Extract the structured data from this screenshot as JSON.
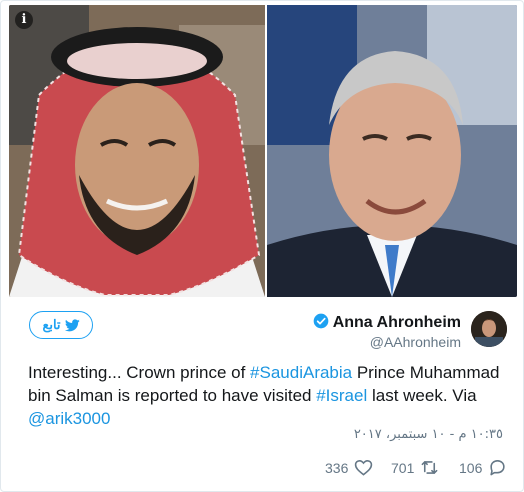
{
  "media": {
    "info_icon": "info-icon",
    "left_photo": "portrait-photo",
    "right_photo": "portrait-photo"
  },
  "header": {
    "follow_label": "تابع",
    "display_name": "Anna Ahronheim",
    "handle": "@AAhronheim",
    "verified_icon": "verified-badge-icon"
  },
  "tweet": {
    "text_part1": "Interesting... Crown prince of ",
    "hashtag1": "#SaudiArabia",
    "text_part2": " Prince Muhammad bin Salman is reported to have visited ",
    "hashtag2": "#Israel",
    "text_part3": " last week. Via ",
    "mention": "@arik3000"
  },
  "timestamp": "١٠:٣٥ م - ١٠ سبتمبر، ٢٠١٧",
  "actions": {
    "likes": "336",
    "retweets": "701",
    "replies": "106"
  },
  "colors": {
    "accent": "#1da1f2",
    "link": "#1b95e0",
    "muted": "#657786",
    "text": "#14171a"
  }
}
